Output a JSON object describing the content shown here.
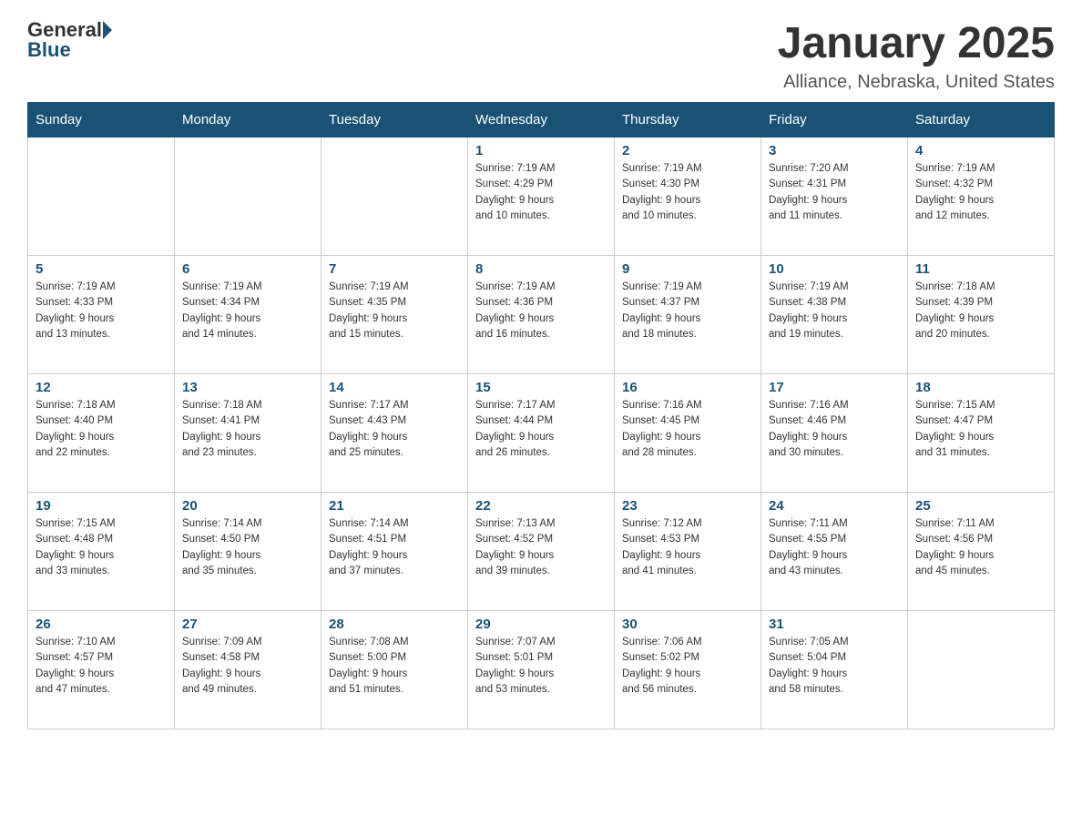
{
  "header": {
    "logo_general": "General",
    "logo_blue": "Blue",
    "month_title": "January 2025",
    "location": "Alliance, Nebraska, United States"
  },
  "weekdays": [
    "Sunday",
    "Monday",
    "Tuesday",
    "Wednesday",
    "Thursday",
    "Friday",
    "Saturday"
  ],
  "weeks": [
    [
      {
        "day": "",
        "info": ""
      },
      {
        "day": "",
        "info": ""
      },
      {
        "day": "",
        "info": ""
      },
      {
        "day": "1",
        "info": "Sunrise: 7:19 AM\nSunset: 4:29 PM\nDaylight: 9 hours\nand 10 minutes."
      },
      {
        "day": "2",
        "info": "Sunrise: 7:19 AM\nSunset: 4:30 PM\nDaylight: 9 hours\nand 10 minutes."
      },
      {
        "day": "3",
        "info": "Sunrise: 7:20 AM\nSunset: 4:31 PM\nDaylight: 9 hours\nand 11 minutes."
      },
      {
        "day": "4",
        "info": "Sunrise: 7:19 AM\nSunset: 4:32 PM\nDaylight: 9 hours\nand 12 minutes."
      }
    ],
    [
      {
        "day": "5",
        "info": "Sunrise: 7:19 AM\nSunset: 4:33 PM\nDaylight: 9 hours\nand 13 minutes."
      },
      {
        "day": "6",
        "info": "Sunrise: 7:19 AM\nSunset: 4:34 PM\nDaylight: 9 hours\nand 14 minutes."
      },
      {
        "day": "7",
        "info": "Sunrise: 7:19 AM\nSunset: 4:35 PM\nDaylight: 9 hours\nand 15 minutes."
      },
      {
        "day": "8",
        "info": "Sunrise: 7:19 AM\nSunset: 4:36 PM\nDaylight: 9 hours\nand 16 minutes."
      },
      {
        "day": "9",
        "info": "Sunrise: 7:19 AM\nSunset: 4:37 PM\nDaylight: 9 hours\nand 18 minutes."
      },
      {
        "day": "10",
        "info": "Sunrise: 7:19 AM\nSunset: 4:38 PM\nDaylight: 9 hours\nand 19 minutes."
      },
      {
        "day": "11",
        "info": "Sunrise: 7:18 AM\nSunset: 4:39 PM\nDaylight: 9 hours\nand 20 minutes."
      }
    ],
    [
      {
        "day": "12",
        "info": "Sunrise: 7:18 AM\nSunset: 4:40 PM\nDaylight: 9 hours\nand 22 minutes."
      },
      {
        "day": "13",
        "info": "Sunrise: 7:18 AM\nSunset: 4:41 PM\nDaylight: 9 hours\nand 23 minutes."
      },
      {
        "day": "14",
        "info": "Sunrise: 7:17 AM\nSunset: 4:43 PM\nDaylight: 9 hours\nand 25 minutes."
      },
      {
        "day": "15",
        "info": "Sunrise: 7:17 AM\nSunset: 4:44 PM\nDaylight: 9 hours\nand 26 minutes."
      },
      {
        "day": "16",
        "info": "Sunrise: 7:16 AM\nSunset: 4:45 PM\nDaylight: 9 hours\nand 28 minutes."
      },
      {
        "day": "17",
        "info": "Sunrise: 7:16 AM\nSunset: 4:46 PM\nDaylight: 9 hours\nand 30 minutes."
      },
      {
        "day": "18",
        "info": "Sunrise: 7:15 AM\nSunset: 4:47 PM\nDaylight: 9 hours\nand 31 minutes."
      }
    ],
    [
      {
        "day": "19",
        "info": "Sunrise: 7:15 AM\nSunset: 4:48 PM\nDaylight: 9 hours\nand 33 minutes."
      },
      {
        "day": "20",
        "info": "Sunrise: 7:14 AM\nSunset: 4:50 PM\nDaylight: 9 hours\nand 35 minutes."
      },
      {
        "day": "21",
        "info": "Sunrise: 7:14 AM\nSunset: 4:51 PM\nDaylight: 9 hours\nand 37 minutes."
      },
      {
        "day": "22",
        "info": "Sunrise: 7:13 AM\nSunset: 4:52 PM\nDaylight: 9 hours\nand 39 minutes."
      },
      {
        "day": "23",
        "info": "Sunrise: 7:12 AM\nSunset: 4:53 PM\nDaylight: 9 hours\nand 41 minutes."
      },
      {
        "day": "24",
        "info": "Sunrise: 7:11 AM\nSunset: 4:55 PM\nDaylight: 9 hours\nand 43 minutes."
      },
      {
        "day": "25",
        "info": "Sunrise: 7:11 AM\nSunset: 4:56 PM\nDaylight: 9 hours\nand 45 minutes."
      }
    ],
    [
      {
        "day": "26",
        "info": "Sunrise: 7:10 AM\nSunset: 4:57 PM\nDaylight: 9 hours\nand 47 minutes."
      },
      {
        "day": "27",
        "info": "Sunrise: 7:09 AM\nSunset: 4:58 PM\nDaylight: 9 hours\nand 49 minutes."
      },
      {
        "day": "28",
        "info": "Sunrise: 7:08 AM\nSunset: 5:00 PM\nDaylight: 9 hours\nand 51 minutes."
      },
      {
        "day": "29",
        "info": "Sunrise: 7:07 AM\nSunset: 5:01 PM\nDaylight: 9 hours\nand 53 minutes."
      },
      {
        "day": "30",
        "info": "Sunrise: 7:06 AM\nSunset: 5:02 PM\nDaylight: 9 hours\nand 56 minutes."
      },
      {
        "day": "31",
        "info": "Sunrise: 7:05 AM\nSunset: 5:04 PM\nDaylight: 9 hours\nand 58 minutes."
      },
      {
        "day": "",
        "info": ""
      }
    ]
  ]
}
